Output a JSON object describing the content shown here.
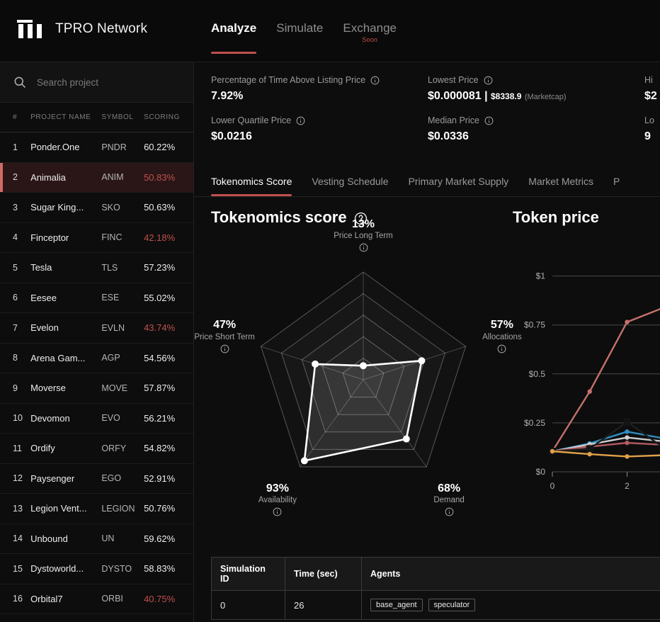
{
  "brand": {
    "name": "TPRO Network",
    "logo_icon": "tpro-bars-logo"
  },
  "main_tabs": [
    {
      "label": "Analyze",
      "active": true,
      "badge": ""
    },
    {
      "label": "Simulate",
      "active": false,
      "badge": ""
    },
    {
      "label": "Exchange",
      "active": false,
      "badge": "Soon"
    }
  ],
  "search": {
    "placeholder": "Search project",
    "icon": "search-icon"
  },
  "project_list": {
    "headers": {
      "num": "#",
      "name": "PROJECT NAME",
      "symbol": "SYMBOL",
      "scoring": "SCORING"
    },
    "rows": [
      {
        "num": "1",
        "name": "Ponder.One",
        "symbol": "PNDR",
        "scoring": "60.22%",
        "low": false,
        "selected": false
      },
      {
        "num": "2",
        "name": "Animalia",
        "symbol": "ANIM",
        "scoring": "50.83%",
        "low": true,
        "selected": true
      },
      {
        "num": "3",
        "name": "Sugar King...",
        "symbol": "SKO",
        "scoring": "50.63%",
        "low": false,
        "selected": false
      },
      {
        "num": "4",
        "name": "Finceptor",
        "symbol": "FINC",
        "scoring": "42.18%",
        "low": true,
        "selected": false
      },
      {
        "num": "5",
        "name": "Tesla",
        "symbol": "TLS",
        "scoring": "57.23%",
        "low": false,
        "selected": false
      },
      {
        "num": "6",
        "name": "Eesee",
        "symbol": "ESE",
        "scoring": "55.02%",
        "low": false,
        "selected": false
      },
      {
        "num": "7",
        "name": "Evelon",
        "symbol": "EVLN",
        "scoring": "43.74%",
        "low": true,
        "selected": false
      },
      {
        "num": "8",
        "name": "Arena Gam...",
        "symbol": "AGP",
        "scoring": "54.56%",
        "low": false,
        "selected": false
      },
      {
        "num": "9",
        "name": "Moverse",
        "symbol": "MOVE",
        "scoring": "57.87%",
        "low": false,
        "selected": false
      },
      {
        "num": "10",
        "name": "Devomon",
        "symbol": "EVO",
        "scoring": "56.21%",
        "low": false,
        "selected": false
      },
      {
        "num": "11",
        "name": "Ordify",
        "symbol": "ORFY",
        "scoring": "54.82%",
        "low": false,
        "selected": false
      },
      {
        "num": "12",
        "name": "Paysenger",
        "symbol": "EGO",
        "scoring": "52.91%",
        "low": false,
        "selected": false
      },
      {
        "num": "13",
        "name": "Legion Vent...",
        "symbol": "LEGION",
        "scoring": "50.76%",
        "low": false,
        "selected": false
      },
      {
        "num": "14",
        "name": "Unbound",
        "symbol": "UN",
        "scoring": "59.62%",
        "low": false,
        "selected": false
      },
      {
        "num": "15",
        "name": "Dystoworld...",
        "symbol": "DYSTO",
        "scoring": "58.83%",
        "low": false,
        "selected": false
      },
      {
        "num": "16",
        "name": "Orbital7",
        "symbol": "ORBI",
        "scoring": "40.75%",
        "low": true,
        "selected": false
      }
    ]
  },
  "metrics": [
    {
      "label": "Percentage of Time Above Listing Price",
      "value": "7.92%"
    },
    {
      "label": "Lowest Price",
      "value": "$0.000081 | ",
      "sub": "$8338.9",
      "note": "(Marketcap)"
    },
    {
      "label": "Hi",
      "value": "$2"
    },
    {
      "label": "Lower Quartile Price",
      "value": "$0.0216"
    },
    {
      "label": "Median Price",
      "value": "$0.0336"
    },
    {
      "label": "Lo",
      "value": "9"
    }
  ],
  "sub_tabs": [
    {
      "label": "Tokenomics Score",
      "active": true
    },
    {
      "label": "Vesting Schedule",
      "active": false
    },
    {
      "label": "Primary Market Supply",
      "active": false
    },
    {
      "label": "Market Metrics",
      "active": false
    },
    {
      "label": "P",
      "active": false
    }
  ],
  "panels": {
    "radar_title": "Tokenomics score",
    "price_title": "Token price"
  },
  "chart_data": [
    {
      "type": "radar",
      "title": "Tokenomics score",
      "categories": [
        "Price Long Term",
        "Allocations",
        "Demand",
        "Availability",
        "Price Short Term"
      ],
      "values": [
        13,
        57,
        68,
        93,
        47
      ],
      "unit": "%",
      "rmax": 100,
      "rings": 5,
      "series": [
        {
          "name": "Tokenomics score",
          "values": [
            13,
            57,
            68,
            93,
            47
          ]
        }
      ],
      "legend": "none",
      "grid": true
    },
    {
      "type": "line",
      "title": "Token price",
      "xlabel": "",
      "ylabel": "",
      "x": [
        0,
        1,
        2,
        3
      ],
      "ytick_labels": [
        "$0",
        "$0.25",
        "$0.5",
        "$0.75",
        "$1"
      ],
      "ytick_values": [
        0,
        0.25,
        0.5,
        0.75,
        1
      ],
      "xtick_labels": [
        "0",
        "2"
      ],
      "xtick_values": [
        0,
        2
      ],
      "ylim": [
        0,
        1.1
      ],
      "grid": true,
      "legend": "none",
      "series": [
        {
          "name": "series-red",
          "color": "#c4706c",
          "values": [
            0.105,
            0.41,
            0.765,
            0.84
          ]
        },
        {
          "name": "series-blue",
          "color": "#2f8fc4",
          "values": [
            0.105,
            0.145,
            0.205,
            0.17
          ]
        },
        {
          "name": "series-white",
          "color": "#cfcfcf",
          "values": [
            0.105,
            0.14,
            0.175,
            0.155
          ]
        },
        {
          "name": "series-pink",
          "color": "#b55a63",
          "values": [
            0.105,
            0.128,
            0.148,
            0.138
          ]
        },
        {
          "name": "series-dark",
          "color": "#1f1f1f",
          "values": [
            0.105,
            0.118,
            0.255,
            0.12
          ]
        },
        {
          "name": "series-orange",
          "color": "#e0a14a",
          "values": [
            0.105,
            0.09,
            0.078,
            0.085
          ]
        }
      ]
    }
  ],
  "sim_table": {
    "headers": [
      "Simulation ID",
      "Time (sec)",
      "Agents"
    ],
    "rows": [
      {
        "id": "0",
        "time": "26",
        "agents": [
          "base_agent",
          "speculator"
        ]
      }
    ]
  },
  "colors": {
    "accent": "#c0504d",
    "bg": "#0d0d0d",
    "panel": "#131313",
    "text": "#ffffff",
    "muted": "#9b9b9b"
  }
}
